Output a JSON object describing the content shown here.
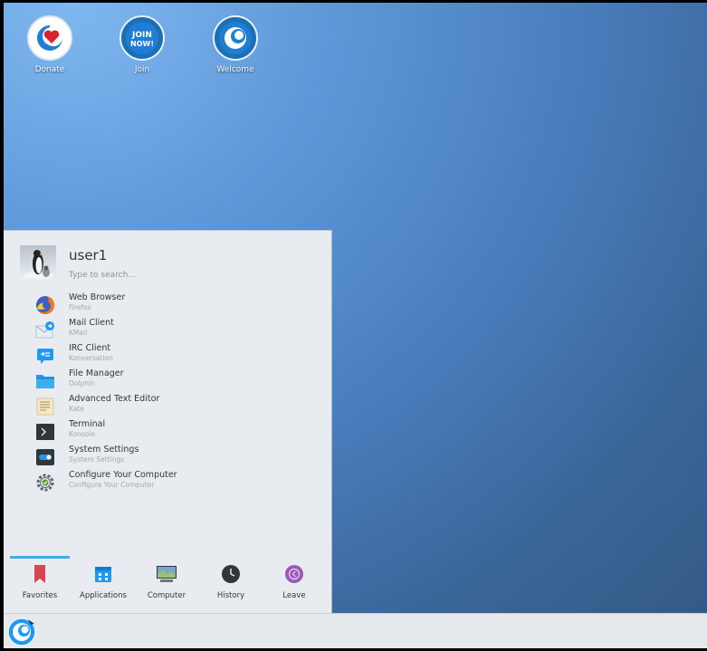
{
  "desktop": {
    "icons": [
      {
        "label": "Donate",
        "icon": "donate-heart-icon"
      },
      {
        "label": "Join",
        "icon": "join-now-icon"
      },
      {
        "label": "Welcome",
        "icon": "opensuse-welcome-icon"
      }
    ],
    "join_badge_line1": "JOIN",
    "join_badge_line2": "NOW!"
  },
  "launcher": {
    "username": "user1",
    "search_placeholder": "Type to search...",
    "apps": [
      {
        "name": "Web Browser",
        "desc": "Firefox",
        "icon": "firefox-icon"
      },
      {
        "name": "Mail Client",
        "desc": "KMail",
        "icon": "kmail-icon"
      },
      {
        "name": "IRC Client",
        "desc": "Konversation",
        "icon": "konversation-icon"
      },
      {
        "name": "File Manager",
        "desc": "Dolphin",
        "icon": "dolphin-folder-icon"
      },
      {
        "name": "Advanced Text Editor",
        "desc": "Kate",
        "icon": "kate-editor-icon"
      },
      {
        "name": "Terminal",
        "desc": "Konsole",
        "icon": "terminal-icon"
      },
      {
        "name": "System Settings",
        "desc": "System Settings",
        "icon": "system-settings-icon"
      },
      {
        "name": "Configure Your Computer",
        "desc": "Configure Your Computer",
        "icon": "configure-gear-icon"
      }
    ],
    "tabs": [
      {
        "label": "Favorites",
        "icon": "bookmark-icon",
        "active": true
      },
      {
        "label": "Applications",
        "icon": "applications-icon",
        "active": false
      },
      {
        "label": "Computer",
        "icon": "computer-icon",
        "active": false
      },
      {
        "label": "History",
        "icon": "history-clock-icon",
        "active": false
      },
      {
        "label": "Leave",
        "icon": "leave-icon",
        "active": false
      }
    ]
  },
  "colors": {
    "accent": "#3daee9",
    "text": "#31363b",
    "subtext": "#a3a8ae",
    "panel_bg": "#e8ecf1"
  }
}
